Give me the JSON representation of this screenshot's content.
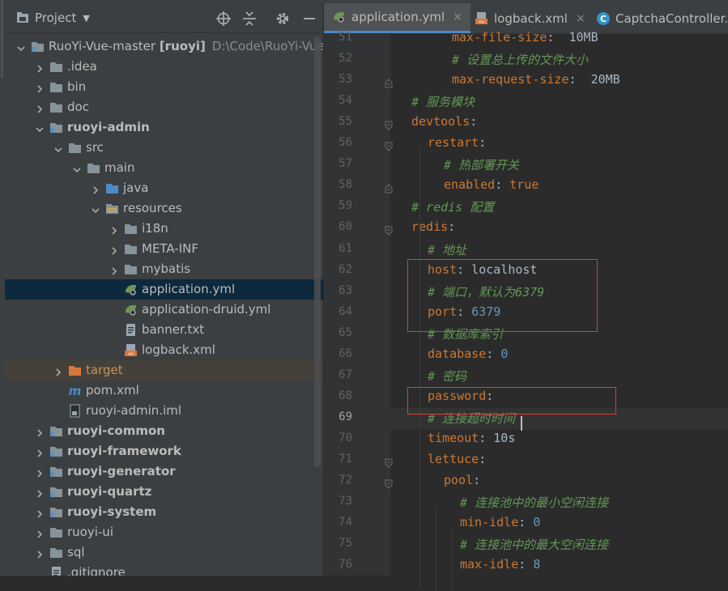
{
  "project_panel": {
    "title": "Project",
    "tree": [
      {
        "label": "RuoYi-Vue-master [ruoyi]",
        "hint": "D:\\Code\\RuoYi-Vue-",
        "depth": 0,
        "expanded": true,
        "icon": "module-folder",
        "bold": false
      },
      {
        "label": ".idea",
        "depth": 1,
        "expanded": false,
        "icon": "folder"
      },
      {
        "label": "bin",
        "depth": 1,
        "expanded": false,
        "icon": "folder"
      },
      {
        "label": "doc",
        "depth": 1,
        "expanded": false,
        "icon": "folder"
      },
      {
        "label": "ruoyi-admin",
        "depth": 1,
        "expanded": true,
        "icon": "module-folder",
        "bold": true
      },
      {
        "label": "src",
        "depth": 2,
        "expanded": true,
        "icon": "folder"
      },
      {
        "label": "main",
        "depth": 3,
        "expanded": true,
        "icon": "folder"
      },
      {
        "label": "java",
        "depth": 4,
        "expanded": false,
        "icon": "source-folder"
      },
      {
        "label": "resources",
        "depth": 4,
        "expanded": true,
        "icon": "resources-folder"
      },
      {
        "label": "i18n",
        "depth": 5,
        "expanded": false,
        "icon": "folder"
      },
      {
        "label": "META-INF",
        "depth": 5,
        "expanded": false,
        "icon": "folder"
      },
      {
        "label": "mybatis",
        "depth": 5,
        "expanded": false,
        "icon": "folder"
      },
      {
        "label": "application.yml",
        "depth": 5,
        "icon": "spring-yaml-file",
        "selected": true
      },
      {
        "label": "application-druid.yml",
        "depth": 5,
        "icon": "spring-yaml-file"
      },
      {
        "label": "banner.txt",
        "depth": 5,
        "icon": "text-file"
      },
      {
        "label": "logback.xml",
        "depth": 5,
        "icon": "xml-file"
      },
      {
        "label": "target",
        "depth": 2,
        "expanded": false,
        "icon": "excluded-folder",
        "excluded": true
      },
      {
        "label": "pom.xml",
        "depth": 2,
        "icon": "maven-file"
      },
      {
        "label": "ruoyi-admin.iml",
        "depth": 2,
        "icon": "iml-file"
      },
      {
        "label": "ruoyi-common",
        "depth": 1,
        "expanded": false,
        "icon": "module-folder",
        "bold": true
      },
      {
        "label": "ruoyi-framework",
        "depth": 1,
        "expanded": false,
        "icon": "module-folder",
        "bold": true
      },
      {
        "label": "ruoyi-generator",
        "depth": 1,
        "expanded": false,
        "icon": "module-folder",
        "bold": true
      },
      {
        "label": "ruoyi-quartz",
        "depth": 1,
        "expanded": false,
        "icon": "module-folder",
        "bold": true
      },
      {
        "label": "ruoyi-system",
        "depth": 1,
        "expanded": false,
        "icon": "module-folder",
        "bold": true
      },
      {
        "label": "ruoyi-ui",
        "depth": 1,
        "expanded": false,
        "icon": "folder"
      },
      {
        "label": "sql",
        "depth": 1,
        "expanded": false,
        "icon": "folder"
      },
      {
        "label": ".gitignore",
        "depth": 1,
        "icon": "text-file"
      }
    ]
  },
  "editor": {
    "tabs": [
      {
        "label": "application.yml",
        "icon": "spring-yaml-file",
        "active": true,
        "close": "×"
      },
      {
        "label": "logback.xml",
        "icon": "xml-file",
        "active": false,
        "close": "×"
      },
      {
        "label": "CaptchaController.j",
        "icon": "java-class-file",
        "active": false
      }
    ],
    "current_line": 69,
    "lines": [
      {
        "num": 51,
        "indent": 5,
        "tokens": [
          {
            "t": "max-file-size",
            "c": "k"
          },
          {
            "t": ":  10MB",
            "c": ""
          }
        ]
      },
      {
        "num": 52,
        "indent": 5,
        "tokens": [
          {
            "t": "# 设置总上传的文件大小",
            "c": "c"
          }
        ]
      },
      {
        "num": 53,
        "indent": 5,
        "tokens": [
          {
            "t": "max-request-size",
            "c": "k"
          },
          {
            "t": ":  20MB",
            "c": ""
          }
        ]
      },
      {
        "num": 54,
        "indent": 0,
        "tokens": [
          {
            "t": "# 服务模块",
            "c": "c"
          }
        ]
      },
      {
        "num": 55,
        "indent": 0,
        "tokens": [
          {
            "t": "devtools",
            "c": "k"
          },
          {
            "t": ":",
            "c": ""
          }
        ]
      },
      {
        "num": 56,
        "indent": 2,
        "tokens": [
          {
            "t": "restart",
            "c": "k"
          },
          {
            "t": ":",
            "c": ""
          }
        ]
      },
      {
        "num": 57,
        "indent": 4,
        "tokens": [
          {
            "t": "# 热部署开关",
            "c": "c"
          }
        ]
      },
      {
        "num": 58,
        "indent": 4,
        "tokens": [
          {
            "t": "enabled",
            "c": "k"
          },
          {
            "t": ": ",
            "c": ""
          },
          {
            "t": "true",
            "c": "k"
          }
        ]
      },
      {
        "num": 59,
        "indent": 0,
        "tokens": [
          {
            "t": "# redis 配置",
            "c": "c"
          }
        ]
      },
      {
        "num": 60,
        "indent": 0,
        "tokens": [
          {
            "t": "redis",
            "c": "k"
          },
          {
            "t": ":",
            "c": ""
          }
        ]
      },
      {
        "num": 61,
        "indent": 2,
        "tokens": [
          {
            "t": "# 地址",
            "c": "c"
          }
        ]
      },
      {
        "num": 62,
        "indent": 2,
        "tokens": [
          {
            "t": "host",
            "c": "k"
          },
          {
            "t": ": localhost",
            "c": ""
          }
        ]
      },
      {
        "num": 63,
        "indent": 2,
        "tokens": [
          {
            "t": "# 端口，默认为6379",
            "c": "c"
          }
        ]
      },
      {
        "num": 64,
        "indent": 2,
        "tokens": [
          {
            "t": "port",
            "c": "k"
          },
          {
            "t": ": ",
            "c": ""
          },
          {
            "t": "6379",
            "c": "n"
          }
        ]
      },
      {
        "num": 65,
        "indent": 2,
        "tokens": [
          {
            "t": "# 数据库索引",
            "c": "c"
          }
        ]
      },
      {
        "num": 66,
        "indent": 2,
        "tokens": [
          {
            "t": "database",
            "c": "k"
          },
          {
            "t": ": ",
            "c": ""
          },
          {
            "t": "0",
            "c": "n"
          }
        ]
      },
      {
        "num": 67,
        "indent": 2,
        "tokens": [
          {
            "t": "# 密码",
            "c": "c"
          }
        ]
      },
      {
        "num": 68,
        "indent": 2,
        "tokens": [
          {
            "t": "password",
            "c": "k"
          },
          {
            "t": ":",
            "c": ""
          }
        ]
      },
      {
        "num": 69,
        "indent": 2,
        "tokens": [
          {
            "t": "# 连接超时时间",
            "c": "c"
          }
        ]
      },
      {
        "num": 70,
        "indent": 2,
        "tokens": [
          {
            "t": "timeout",
            "c": "k"
          },
          {
            "t": ": 10s",
            "c": ""
          }
        ]
      },
      {
        "num": 71,
        "indent": 2,
        "tokens": [
          {
            "t": "lettuce",
            "c": "k"
          },
          {
            "t": ":",
            "c": ""
          }
        ]
      },
      {
        "num": 72,
        "indent": 4,
        "tokens": [
          {
            "t": "pool",
            "c": "k"
          },
          {
            "t": ":",
            "c": ""
          }
        ]
      },
      {
        "num": 73,
        "indent": 6,
        "tokens": [
          {
            "t": "# 连接池中的最小空闲连接",
            "c": "c"
          }
        ]
      },
      {
        "num": 74,
        "indent": 6,
        "tokens": [
          {
            "t": "min-idle",
            "c": "k"
          },
          {
            "t": ": ",
            "c": ""
          },
          {
            "t": "0",
            "c": "n"
          }
        ]
      },
      {
        "num": 75,
        "indent": 6,
        "tokens": [
          {
            "t": "# 连接池中的最大空闲连接",
            "c": "c"
          }
        ]
      },
      {
        "num": 76,
        "indent": 6,
        "tokens": [
          {
            "t": "max-idle",
            "c": "k"
          },
          {
            "t": ": ",
            "c": ""
          },
          {
            "t": "8",
            "c": "n"
          }
        ]
      }
    ]
  },
  "colors": {
    "keyword": "#cc7832",
    "comment": "#629755",
    "number": "#6897bb",
    "selection": "#0d293e",
    "excluded": "#45413a",
    "highlight_box": "#e03a3a"
  }
}
